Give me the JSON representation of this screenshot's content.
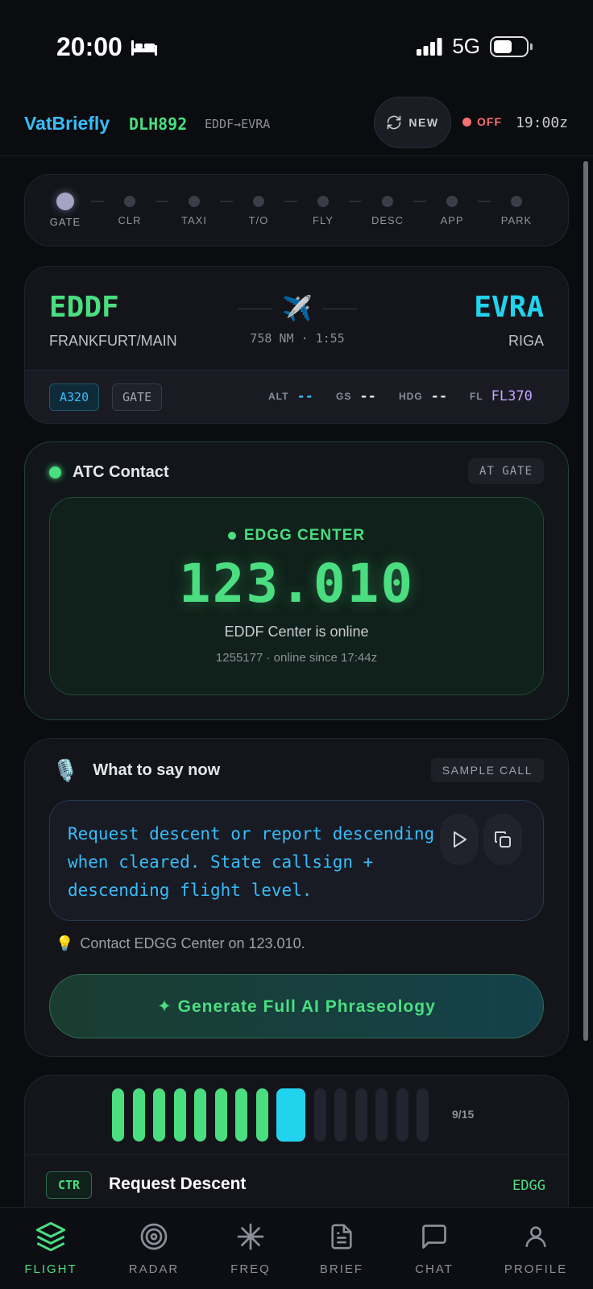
{
  "status_bar": {
    "time": "20:00",
    "network": "5G"
  },
  "header": {
    "brand": "VatBriefly",
    "callsign": "DLH892",
    "route": "EDDF→EVRA",
    "new_label": "NEW",
    "status_label": "OFF",
    "zulu_time": "19:00z"
  },
  "phases": {
    "items": [
      "GATE",
      "CLR",
      "TAXI",
      "T/O",
      "FLY",
      "DESC",
      "APP",
      "PARK"
    ],
    "active": "GATE"
  },
  "route_card": {
    "departure_code": "EDDF",
    "departure_name": "FRANKFURT/MAIN",
    "arrival_code": "EVRA",
    "arrival_name": "RIGA",
    "plane_glyph": "✈️",
    "distance_time": "758 NM · 1:55",
    "aircraft": "A320",
    "position": "GATE",
    "alt_label": "ALT",
    "alt_value": "--",
    "gs_label": "GS",
    "gs_value": "--",
    "hdg_label": "HDG",
    "hdg_value": "--",
    "fl_label": "FL",
    "fl_value": "FL370"
  },
  "atc": {
    "title": "ATC Contact",
    "badge": "AT GATE",
    "station": "EDGG CENTER",
    "frequency": "123.010",
    "online_text": "EDDF Center is online",
    "since_text": "1255177 · online since 17:44z"
  },
  "say": {
    "mic_glyph": "🎙️",
    "title": "What to say now",
    "badge": "SAMPLE CALL",
    "text": "Request descent or report descending when cleared. State callsign + descending flight level.",
    "tip_glyph": "💡",
    "tip": "Contact EDGG Center on 123.010.",
    "generate_label": "✦ Generate Full AI Phraseology"
  },
  "progress": {
    "total": 15,
    "current": 9,
    "counter": "9/15",
    "facility_type": "CTR",
    "step_title": "Request Descent",
    "facility": "EDGG"
  },
  "tabs": [
    {
      "label": "FLIGHT",
      "icon": "layers-icon"
    },
    {
      "label": "RADAR",
      "icon": "radar-icon"
    },
    {
      "label": "FREQ",
      "icon": "sparkle-icon"
    },
    {
      "label": "BRIEF",
      "icon": "document-icon"
    },
    {
      "label": "CHAT",
      "icon": "chat-icon"
    },
    {
      "label": "PROFILE",
      "icon": "person-icon"
    }
  ],
  "colors": {
    "accent_green": "#4ade80",
    "accent_cyan": "#22d3ee",
    "accent_blue": "#38bdf8",
    "accent_red": "#f87171",
    "fl_purple": "#c4a8ff"
  }
}
